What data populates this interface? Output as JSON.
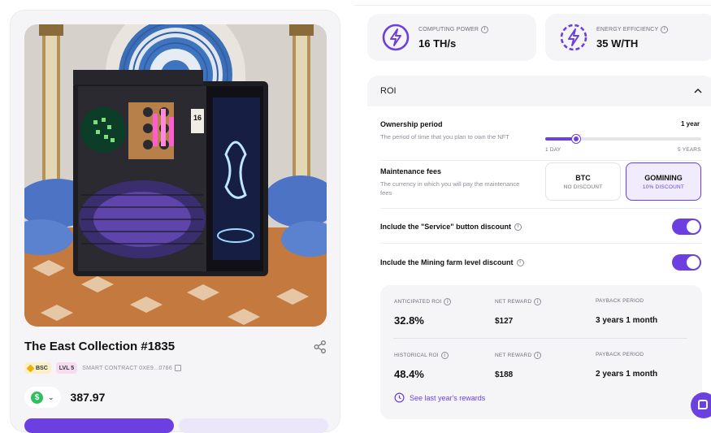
{
  "nft": {
    "title": "The East Collection #1835",
    "chain": "BSC",
    "level": "LVL 5",
    "contract": "SMART CONTRACT 0XE9...0766",
    "price": "387.97",
    "currency_symbol": "$",
    "miner_plate": "16\n38WTH",
    "image_alt": "Bitcoin mining rig in a Middle-East styled room"
  },
  "stats": {
    "computing_power": {
      "label": "COMPUTING POWER",
      "value": "16 TH/s",
      "icon": "lightning-circle-icon"
    },
    "energy_efficiency": {
      "label": "ENERGY EFFICIENCY",
      "value": "35 W/TH",
      "icon": "lightning-dashed-circle-icon"
    }
  },
  "roi": {
    "title": "ROI",
    "ownership": {
      "title": "Ownership period",
      "subtitle": "The period of time that you plan to own the NFT",
      "value": "1 year",
      "min_label": "1 DAY",
      "max_label": "5 YEARS",
      "slider_fraction": 0.2
    },
    "maintenance": {
      "title": "Maintenance fees",
      "subtitle": "The currency in which you will pay the maintenance fees",
      "options": [
        {
          "title": "BTC",
          "subtitle": "NO DISCOUNT"
        },
        {
          "title": "GOMINING",
          "subtitle": "10% DISCOUNT"
        }
      ],
      "selected": "GOMINING"
    },
    "toggles": [
      {
        "label": "Include the \"Service\" button discount",
        "on": true
      },
      {
        "label": "Include the Mining farm level discount",
        "on": true
      }
    ],
    "anticipated": {
      "roi_label": "ANTICIPATED ROI",
      "roi_value": "32.8%",
      "net_label": "NET REWARD",
      "net_value": "$127",
      "payback_label": "PAYBACK PERIOD",
      "payback_value": "3 years 1 month"
    },
    "historical": {
      "roi_label": "HISTORICAL ROI",
      "roi_value": "48.4%",
      "net_label": "NET REWARD",
      "net_value": "$188",
      "payback_label": "PAYBACK PERIOD",
      "payback_value": "2 years 1 month"
    },
    "rewards_link": "See last year's rewards"
  },
  "colors": {
    "accent": "#6c3fe0",
    "panel": "#f5f5f7",
    "text": "#111111"
  }
}
